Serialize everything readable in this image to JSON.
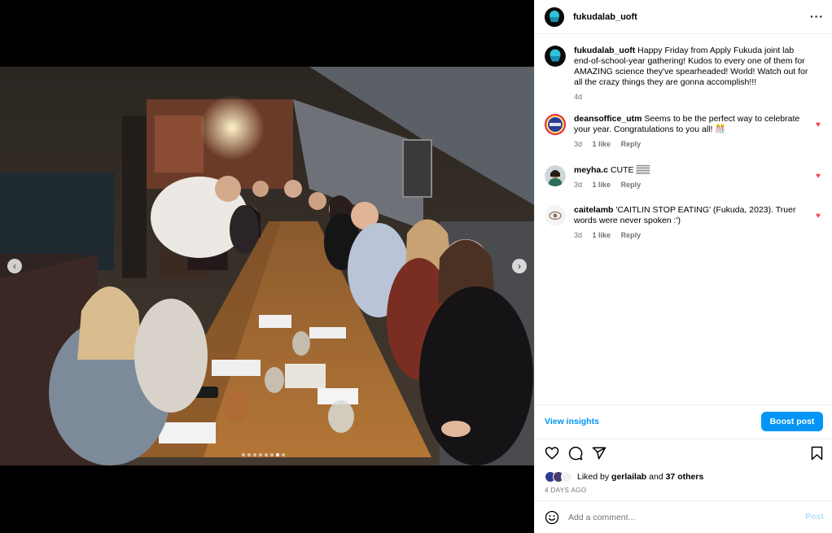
{
  "post": {
    "username": "fukudalab_uoft",
    "caption": "Happy Friday from Apply Fukuda joint lab end-of-school-year gathering! Kudos to every one of them for AMAZING science they've spearheaded! World! Watch out for all the crazy things they are gonna accomplish!!!",
    "caption_age": "4d",
    "more_icon": "ellipsis-icon"
  },
  "carousel": {
    "prev_icon": "chevron-left-icon",
    "next_icon": "chevron-right-icon",
    "prev_glyph": "‹",
    "next_glyph": "›",
    "slides": 8,
    "active_slide": 7
  },
  "comments": [
    {
      "username": "deansoffice_utm",
      "text": "Seems to be the perfect way to celebrate your year. Congratulations to you all! 🎊",
      "age": "3d",
      "likes": "1 like",
      "reply": "Reply"
    },
    {
      "username": "meyha.c",
      "text": "CUTE 𝄛𝄛",
      "age": "3d",
      "likes": "1 like",
      "reply": "Reply"
    },
    {
      "username": "caitelamb",
      "text": "'CAITLIN STOP EATING' (Fukuda, 2023). Truer words were never spoken :')",
      "age": "3d",
      "likes": "1 like",
      "reply": "Reply"
    }
  ],
  "insights": {
    "view_label": "View insights",
    "boost_label": "Boost post"
  },
  "liked": {
    "prefix": "Liked by",
    "user": "gerlailab",
    "joiner": "and",
    "others": "37 others",
    "age": "4 DAYS AGO"
  },
  "add_comment": {
    "placeholder": "Add a comment...",
    "post_label": "Post"
  },
  "colors": {
    "accent": "#0095f6",
    "heart": "#ed4956",
    "muted": "#737373",
    "post_disabled": "#b2dffc"
  }
}
